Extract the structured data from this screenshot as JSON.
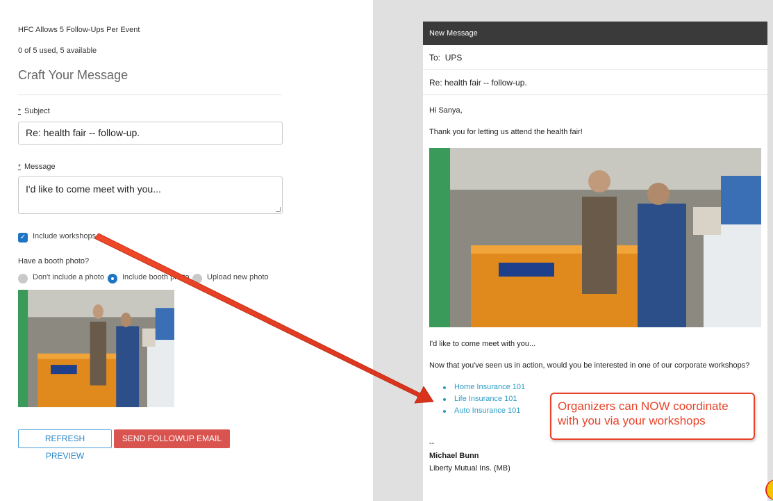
{
  "form": {
    "limit_text": "HFC Allows 5 Follow-Ups Per Event",
    "usage_text": "0 of 5 used, 5 available",
    "heading": "Craft Your Message",
    "required_mark": "*",
    "subject_label": "Subject",
    "subject_value": "Re: health fair -- follow-up.",
    "message_label": "Message",
    "message_value": "I'd like to come meet with you...",
    "include_workshops_label": "Include workshops",
    "include_workshops_checked": true,
    "booth_photo_question": "Have a booth photo?",
    "photo_options": [
      {
        "label": "Don't include a photo",
        "selected": false
      },
      {
        "label": "Include booth photo",
        "selected": true
      },
      {
        "label": "Upload new photo",
        "selected": false
      }
    ],
    "refresh_label": "REFRESH PREVIEW",
    "send_label": "SEND FOLLOWUP EMAIL"
  },
  "preview": {
    "title": "New Message",
    "to_label": "To:",
    "to_value": "UPS",
    "subject": "Re: health fair -- follow-up.",
    "greeting": "Hi Sanya,",
    "thanks": "Thank you for letting us attend the health fair!",
    "message": "I'd like to come meet with you...",
    "workshop_intro": "Now that you've seen us in action, would you be interested in one of our corporate workshops?",
    "workshops": [
      "Home Insurance 101",
      "Life Insurance 101",
      "Auto Insurance 101"
    ],
    "signature_dash": "--",
    "signature_name": "Michael Bunn",
    "signature_company": "Liberty Mutual Ins. (MB)"
  },
  "callout": {
    "text": "Organizers can NOW coordinate with you via your workshops"
  },
  "colors": {
    "accent_blue": "#1f75c4",
    "send_red": "#d9534f",
    "callout_red": "#e8432a",
    "link_blue": "#2a9bc5",
    "table_orange": "#e08a1e"
  }
}
